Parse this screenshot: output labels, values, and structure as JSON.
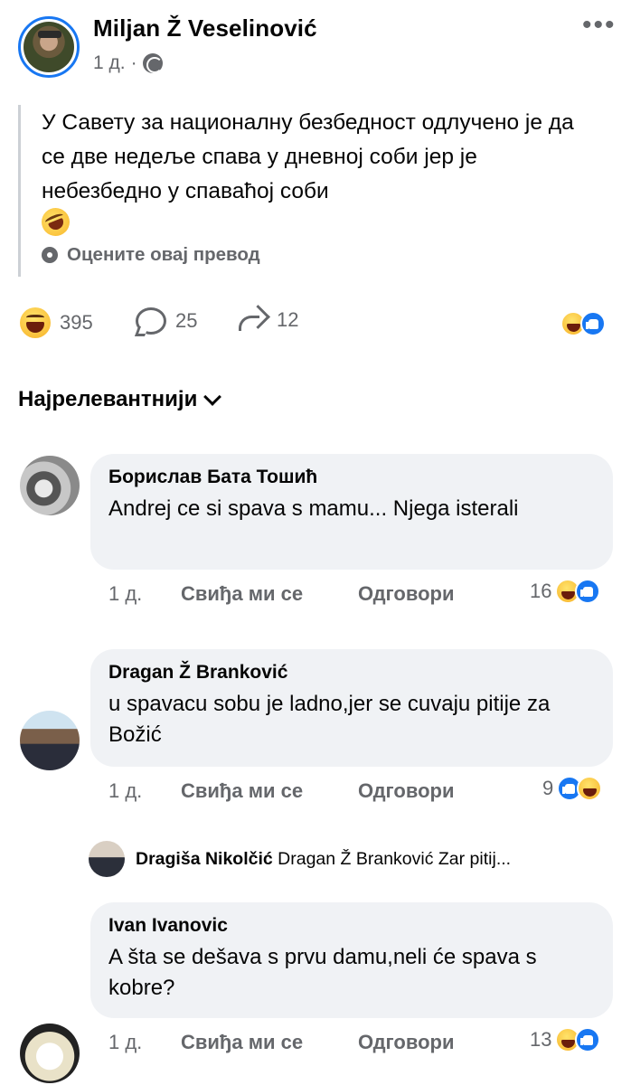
{
  "post": {
    "author": "Miljan Ž Veselinović",
    "time": "1 д.",
    "separator": "·",
    "text": "У Савету за националну безбедност одлучено је да се две недеље спава у дневној соби јер је небезбедно у спаваћој соби",
    "translate_label": "Оцените овај превод",
    "more": "•••"
  },
  "stats": {
    "reactions": "395",
    "comments": "25",
    "shares": "12"
  },
  "sort_label": "Најрелевантнији",
  "comments": [
    {
      "author": "Борислав Бата Тошић",
      "text": "Andrej ce si spava s mamu... Njega isterali",
      "time": "1 д.",
      "like_label": "Свиђа ми се",
      "reply_label": "Одговори",
      "reaction_count": "16"
    },
    {
      "author": "Dragan Ž Branković",
      "text": "u spavacu sobu je ladno,jer se cuvaju pitije za Božić",
      "time": "1 д.",
      "like_label": "Свиђа ми се",
      "reply_label": "Одговори",
      "reaction_count": "9"
    },
    {
      "author": "Ivan Ivanovic",
      "text": "A šta se dešava s prvu damu,neli će spava s kobre?",
      "time": "1 д.",
      "like_label": "Свиђа ми се",
      "reply_label": "Одговори",
      "reaction_count": "13"
    }
  ],
  "reply_preview": {
    "author": "Dragiša Nikolčić",
    "text": "Dragan Ž Branković Zar pitij..."
  },
  "colors": {
    "accent": "#1877f2",
    "bubble": "#f0f2f5",
    "muted": "#65676b"
  }
}
